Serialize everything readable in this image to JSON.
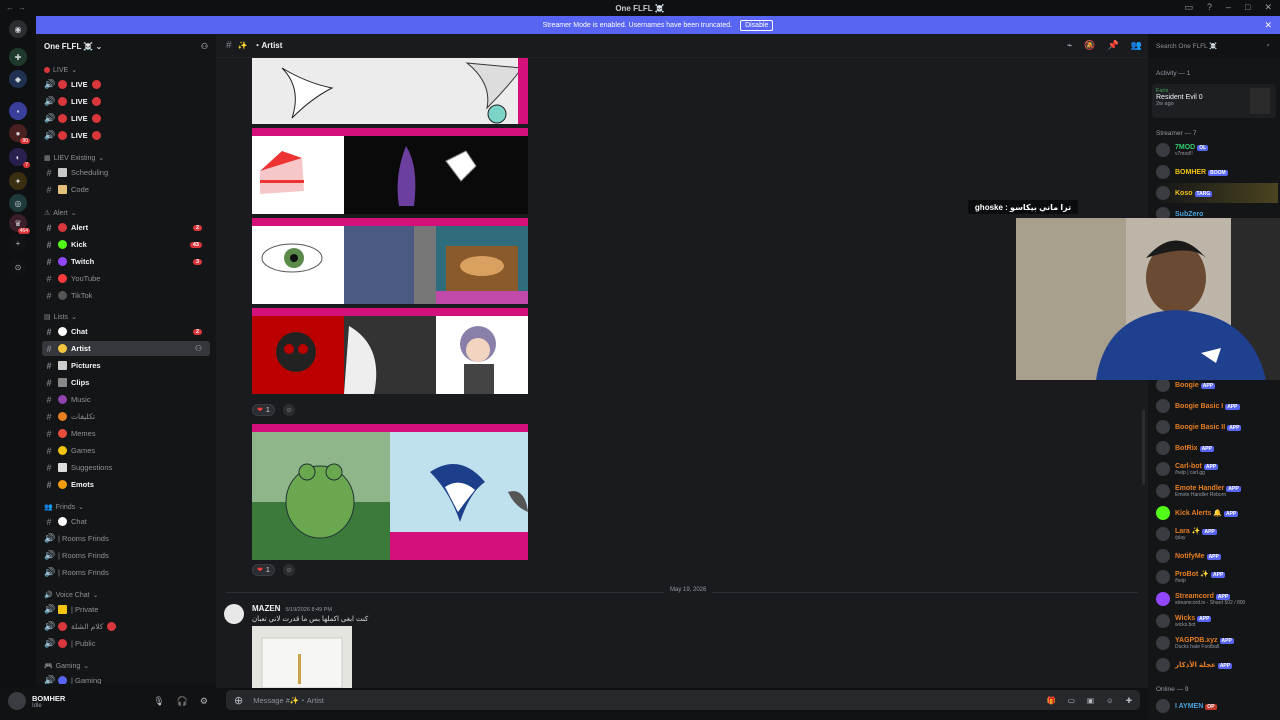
{
  "window": {
    "title": "One FLFL ☠️"
  },
  "banner": {
    "text": "Streamer Mode is enabled. Usernames have been truncated.",
    "button": "Disable"
  },
  "servers": {
    "badges": [
      "90",
      "7",
      "464"
    ]
  },
  "server": {
    "name": "One FLFL ☠️"
  },
  "categories": {
    "live": "LIVE",
    "liev": "LIEV Existing",
    "alert": "Alert",
    "lists": "Lists",
    "frinds": "Frinds",
    "voice": "Voice Chat",
    "gaming": "Gaming"
  },
  "channels": {
    "live1": "LIVE",
    "live2": "LIVE",
    "live3": "LIVE",
    "live4": "LIVE",
    "scheduling": "Scheduling",
    "code": "Code",
    "alert": "Alert",
    "alert_count": "2",
    "kick": "Kick",
    "kick_count": "43",
    "twitch": "Twitch",
    "twitch_count": "3",
    "youtube": "YouTube",
    "tiktok": "TikTok",
    "chat": "Chat",
    "chat_count": "2",
    "artist": "Artist",
    "pictures": "Pictures",
    "clips": "Clips",
    "music": "Music",
    "arabic": "تكليفات",
    "memes": "Memes",
    "games": "Games",
    "suggestions": "Suggestions",
    "emots": "Emots",
    "fchat": "Chat",
    "rooms1": "| Rooms Frinds",
    "rooms2": "| Rooms Frinds",
    "rooms3": "| Rooms Frinds",
    "private": "| Private",
    "voice_ar": "كلام الشلة",
    "public": "| Public",
    "gaming": "| Gaming"
  },
  "user": {
    "name": "BOMHER",
    "status": "Idle"
  },
  "chat": {
    "channel": "Artist",
    "search_placeholder": "Search One FLFL ☠️",
    "reaction1_count": "1",
    "reaction2_count": "1",
    "divider_date": "May 19, 2026",
    "message_author": "MAZEN",
    "message_time": "5/19/2026 8:49 PM",
    "message_text": "كنت ابغى اكملها بس ما قدرت لاني تعبان",
    "input_placeholder": "Message #✨・Artist"
  },
  "members": {
    "activity_header": "Activity — 1",
    "activity_game": "Resident Evil 0",
    "activity_user": "Faris",
    "activity_time": "2w ago",
    "streamer_header": "Streamer — 7",
    "online_header": "Online — 9",
    "list": [
      {
        "name": "7MOD",
        "tag": "OL",
        "sub": "v7mod!!",
        "color": "#2ecc71"
      },
      {
        "name": "BOMHER",
        "tag": "BOOM",
        "sub": "",
        "color": "#f1c40f"
      },
      {
        "name": "Koso",
        "tag": "TARG",
        "sub": "",
        "color": "#f1c40f"
      },
      {
        "name": "SubZero",
        "tag": "",
        "sub": "",
        "color": "#4aa3df"
      }
    ],
    "bots": [
      {
        "name": "Boogie",
        "tag": "APP",
        "sub": ""
      },
      {
        "name": "Boogie Basic I",
        "tag": "APP",
        "sub": ""
      },
      {
        "name": "Boogie Basic II",
        "tag": "APP",
        "sub": ""
      },
      {
        "name": "BotRix",
        "tag": "APP",
        "sub": ""
      },
      {
        "name": "Carl-bot",
        "tag": "APP",
        "sub": "/help | carl.gg"
      },
      {
        "name": "Emote Handler",
        "tag": "APP",
        "sub": "Emote Handler Reborn"
      },
      {
        "name": "Kick Alerts 🔔",
        "tag": "APP",
        "sub": ""
      },
      {
        "name": "Lara ✨",
        "tag": "APP",
        "sub": "/play"
      },
      {
        "name": "NotifyMe",
        "tag": "APP",
        "sub": ""
      },
      {
        "name": "ProBot ✨",
        "tag": "APP",
        "sub": "/help"
      },
      {
        "name": "Streamcord",
        "tag": "APP",
        "sub": "streamcord.io - Shard 502 / 800"
      },
      {
        "name": "Wicks",
        "tag": "APP",
        "sub": "wicks.bot"
      },
      {
        "name": "YAGPDB.xyz",
        "tag": "APP",
        "sub": "Ducks hate Football."
      },
      {
        "name": "عجلة الأذكار",
        "tag": "APP",
        "sub": ""
      }
    ],
    "online_first": "I AYMEN",
    "online_first_tag": "OP"
  },
  "webcam": {
    "caption": "ghoske : ترا ماني بيكاسو"
  }
}
